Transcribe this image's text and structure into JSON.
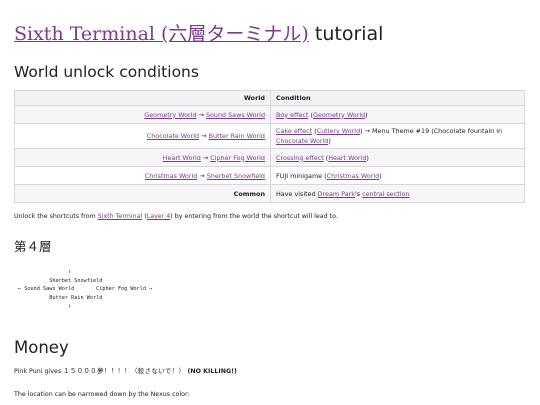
{
  "title": {
    "link_text": "Sixth Terminal (六層ターミナル)",
    "suffix": " tutorial"
  },
  "sections": {
    "unlock_heading": "World unlock conditions",
    "floor_heading": "第４層",
    "money_heading": "Money"
  },
  "table": {
    "headers": [
      "World",
      "Condition"
    ],
    "rows": [
      {
        "world": {
          "from": "Geometry World",
          "arrow": "→",
          "to": "Sound Saws World"
        },
        "condition": {
          "a": "Boy effect",
          "b": " (",
          "c": "Geometry World",
          "d": ")"
        }
      },
      {
        "world": {
          "from": "Chocolate World",
          "arrow": "→",
          "to": "Butter Rain World"
        },
        "condition": {
          "a": "Cake effect",
          "b": " (",
          "c": "Cutlery World",
          "d": ") → Menu Theme #19 (Chocolate fountain in ",
          "e": "Chocolate World",
          "f": ")"
        }
      },
      {
        "world": {
          "from": "Heart World",
          "arrow": "→",
          "to": "Cipher Fog World"
        },
        "condition": {
          "a": "Crossing effect",
          "b": " (",
          "c": "Heart World",
          "d": ")"
        }
      },
      {
        "world": {
          "from": "Christmas World",
          "arrow": "→",
          "to": "Sherbet Snowfield"
        },
        "condition": {
          "a": "FUJI minigame (",
          "b": "Christmas World",
          "c": ")"
        }
      },
      {
        "world": {
          "label": "Common"
        },
        "condition": {
          "a": "Have visited ",
          "b": "Dream Park",
          "c": "'s ",
          "d": "central section"
        }
      }
    ]
  },
  "shortcut_text": {
    "a": "Unlock the shortcuts from ",
    "b": "Sixth Terminal",
    "c": " (",
    "d": "Layer 4",
    "e": ") by entering from the world the shortcut will lead to."
  },
  "map_text": "                ↑\n          Sherbet Snowfield\n← Sound Saws World       Cipher Fog World →\n          Butter Rain World\n                ↓",
  "money": {
    "a": "Pink Puni gives ",
    "b": "１５０００夢！！！！（殺さないで！）",
    "c": " (NO KILLING!)",
    "nexus_text": "The location can be narrowed down by the Nexus color:"
  }
}
